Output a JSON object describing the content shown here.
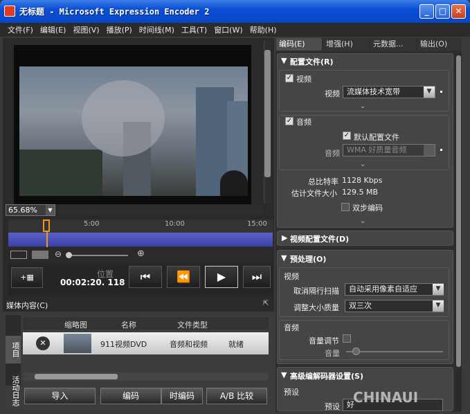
{
  "window": {
    "title": "无标题 - Microsoft Expression Encoder 2",
    "min": "_",
    "max": "□",
    "close": "✕"
  },
  "menu": [
    "文件(F)",
    "编辑(E)",
    "视图(V)",
    "播放(P)",
    "时间线(M)",
    "工具(T)",
    "窗口(W)",
    "帮助(H)"
  ],
  "viewer": {
    "zoom": "65.68%"
  },
  "timeline": {
    "ticks": [
      "5:00",
      "10:00",
      "15:00"
    ]
  },
  "transport": {
    "position_label": "位置",
    "position_value": "00:02:20. 118",
    "buttons": [
      "⏮",
      "⏪",
      "▶",
      "⏭"
    ]
  },
  "media": {
    "title": "媒体内容(C)",
    "side_tabs": [
      "项目",
      "活动日志"
    ],
    "columns": [
      "缩略图",
      "名称",
      "文件类型"
    ],
    "row": {
      "name": "911视频DVD",
      "type": "音频和视频",
      "status": "就绪"
    },
    "buttons": [
      "导入",
      "编码",
      "时编码",
      "A/B 比较"
    ]
  },
  "right": {
    "tabs": [
      "编码(E)",
      "增强(H)",
      "元数据...",
      "输出(O)"
    ],
    "profile": {
      "title": "配置文件(R)",
      "video_check": "视频",
      "video_label": "视频",
      "video_value": "流媒体技术宽带",
      "audio_check": "音频",
      "default_profile": "默认配置文件",
      "audio_label": "音频",
      "audio_value": "WMA 好质量音频",
      "bitrate_label": "总比特率",
      "bitrate_value": "1128 Kbps",
      "size_label": "估计文件大小",
      "size_value": "129.5 MB",
      "twopass": "双步编码"
    },
    "video_profile": "视频配置文件(D)",
    "preprocess": {
      "title": "预处理(O)",
      "video_hdr": "视频",
      "deinterlace_label": "取消隔行扫描",
      "deinterlace_value": "自动采用像素自适应",
      "resize_label": "调整大小质量",
      "resize_value": "双三次",
      "audio_hdr": "音频",
      "volume_adj": "音量调节",
      "volume": "音量"
    },
    "codec": {
      "title": "高级编解码器设置(S)",
      "preset_hdr": "预设",
      "preset_label": "预设",
      "preset_value": "好"
    }
  },
  "watermark": "CHINAUI"
}
